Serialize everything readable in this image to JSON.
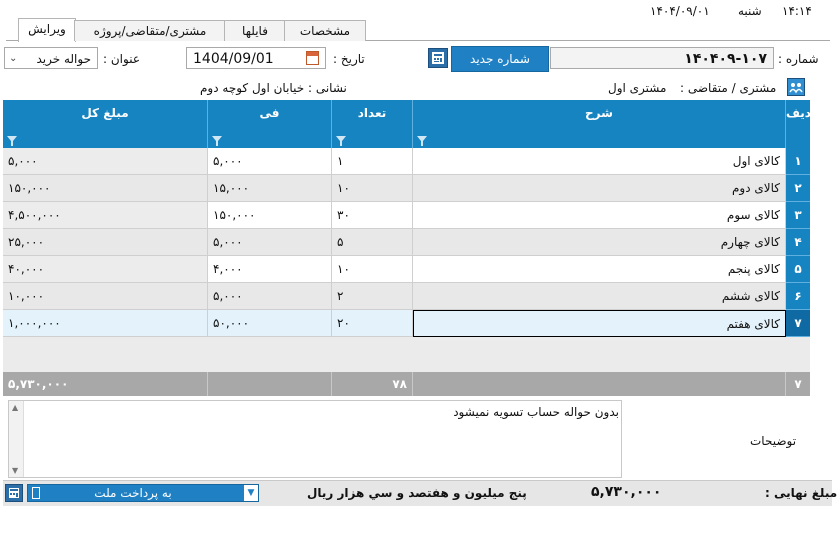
{
  "status": {
    "time": "۱۴:۱۴",
    "day": "شنبه",
    "date": "۱۴۰۴/۰۹/۰۱"
  },
  "tabs": [
    {
      "label": "ویرایش",
      "active": true
    },
    {
      "label": "مشتری/متقاضی/پروژه",
      "active": false
    },
    {
      "label": "فایلها",
      "active": false
    },
    {
      "label": "مشخصات",
      "active": false
    }
  ],
  "form": {
    "number_label": "شماره :",
    "number_value": "۱۴۰۴۰۹-۱۰۷",
    "new_number_button": "شماره جدید",
    "date_label": "تاریخ :",
    "date_value": "1404/09/01",
    "title_label": "عنوان :",
    "title_value": "حواله خرید",
    "customer_label": "مشتری / متقاضی :",
    "customer_value": "مشتری اول",
    "address_label": "نشانی :",
    "address_value": "خیابان اول کوچه دوم"
  },
  "grid": {
    "headers": {
      "row": "ردیف",
      "desc": "شرح",
      "qty": "تعداد",
      "price": "فی",
      "total": "مبلغ کل"
    },
    "rows": [
      {
        "num": "۱",
        "desc": "کالای اول",
        "qty": "۱",
        "price": "۵,۰۰۰",
        "total": "۵,۰۰۰"
      },
      {
        "num": "۲",
        "desc": "کالای دوم",
        "qty": "۱۰",
        "price": "۱۵,۰۰۰",
        "total": "۱۵۰,۰۰۰"
      },
      {
        "num": "۳",
        "desc": "کالای سوم",
        "qty": "۳۰",
        "price": "۱۵۰,۰۰۰",
        "total": "۴,۵۰۰,۰۰۰"
      },
      {
        "num": "۴",
        "desc": "کالای چهارم",
        "qty": "۵",
        "price": "۵,۰۰۰",
        "total": "۲۵,۰۰۰"
      },
      {
        "num": "۵",
        "desc": "کالای پنجم",
        "qty": "۱۰",
        "price": "۴,۰۰۰",
        "total": "۴۰,۰۰۰"
      },
      {
        "num": "۶",
        "desc": "کالای ششم",
        "qty": "۲",
        "price": "۵,۰۰۰",
        "total": "۱۰,۰۰۰"
      },
      {
        "num": "۷",
        "desc": "کالای هفتم",
        "qty": "۲۰",
        "price": "۵۰,۰۰۰",
        "total": "۱,۰۰۰,۰۰۰"
      }
    ],
    "footer": {
      "count": "۷",
      "qty_sum": "۷۸",
      "total_sum": "۵,۷۳۰,۰۰۰"
    }
  },
  "notes": {
    "label": "توضیحات",
    "text": "بدون حواله حساب تسویه نمیشود"
  },
  "bottom": {
    "final_label": "مبلغ نهایی :",
    "final_value": "۵,۷۳۰,۰۰۰",
    "words": "پنج میلیون و هفتصد و سي  هزار  ريال",
    "payment_value": "به پرداخت ملت"
  },
  "colors": {
    "accent": "#1784c2",
    "button": "#1f80c4"
  }
}
